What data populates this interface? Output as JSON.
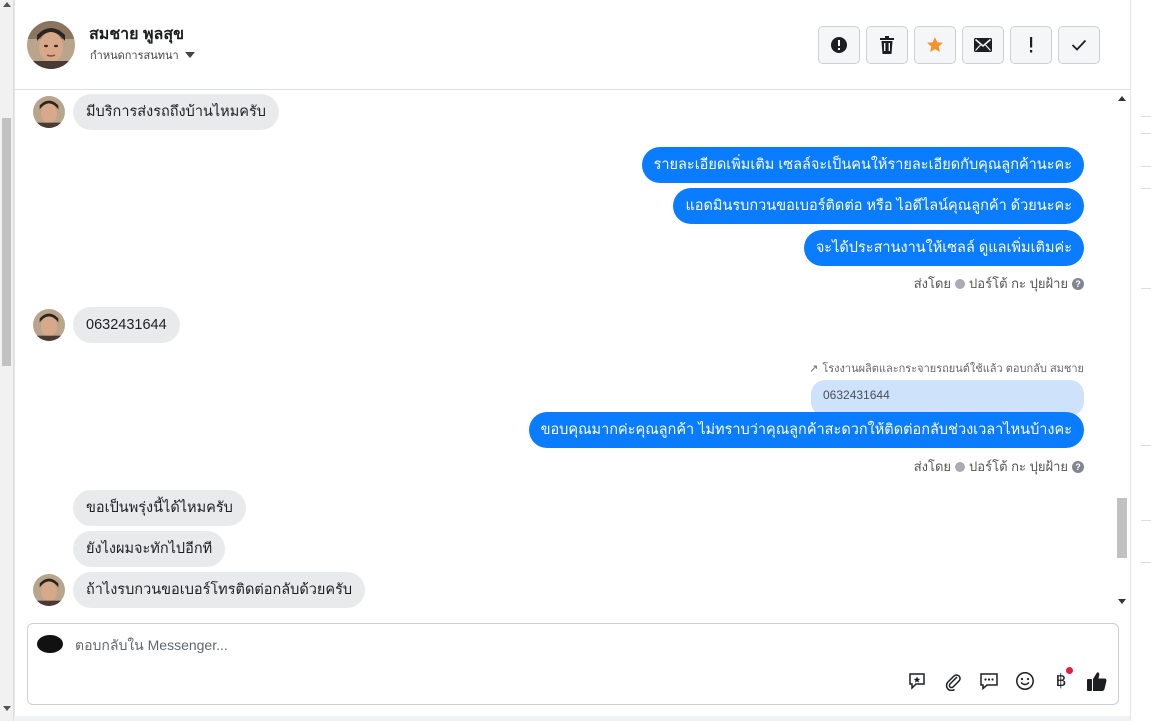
{
  "header": {
    "contact_name": "สมชาย พูลสุข",
    "assign_label": "กำหนดการสนทนา",
    "actions": [
      {
        "name": "report-spam-button",
        "icon": "alert-circle-icon"
      },
      {
        "name": "delete-button",
        "icon": "trash-icon"
      },
      {
        "name": "star-button",
        "icon": "star-icon",
        "color": "#f5922b"
      },
      {
        "name": "mark-unread-button",
        "icon": "envelope-icon"
      },
      {
        "name": "important-button",
        "icon": "exclamation-icon"
      },
      {
        "name": "mark-done-button",
        "icon": "checkmark-icon"
      }
    ]
  },
  "messages": {
    "m1": "มีบริการส่งรถถึงบ้านไหมครับ",
    "o1": "รายละเอียดเพิ่มเติม เซลล์จะเป็นคนให้รายละเอียดกับคุณลูกค้านะคะ",
    "o2": "แอดมินรบกวนขอเบอร์ติดต่อ หรือ ไอดีไลน์คุณลูกค้า ด้วยนะคะ",
    "o3": "จะได้ประสานงานให้เซลล์ ดูแลเพิ่มเติมค่ะ",
    "sent_by_1": "ส่งโดย",
    "sender_1": "ปอร์โต้ กะ ปุยฝ้าย",
    "m2": "0632431644",
    "reply_context": "โรงงานผลิตและกระจายรถยนต์ใช้แล้ว ตอบกลับ สมชาย",
    "quoted": "0632431644",
    "o4": "ขอบคุณมากค่ะคุณลูกค้า ไม่ทราบว่าคุณลูกค้าสะดวกให้ติดต่อกลับช่วงเวลาไหนบ้างคะ",
    "sent_by_2": "ส่งโดย",
    "sender_2": "ปอร์โต้ กะ ปุยฝ้าย",
    "m3": "ขอเป็นพรุ่งนี้ได้ไหมครับ",
    "m4": "ยังไงผมจะทักไปอีกที",
    "m5": "ถ้าไงรบกวนขอเบอร์โทรติดต่อกลับด้วยครับ"
  },
  "composer": {
    "placeholder": "ตอบกลับใน Messenger...",
    "tools": [
      "saved-reply-icon",
      "attachment-icon",
      "chat-bubble-icon",
      "emoji-icon",
      "baht-icon",
      "like-icon"
    ]
  },
  "colors": {
    "outgoing_bubble": "#0a7cff",
    "incoming_bubble": "#e9eaec",
    "quoted_bubble": "#cfe2fb",
    "star": "#f5922b"
  }
}
